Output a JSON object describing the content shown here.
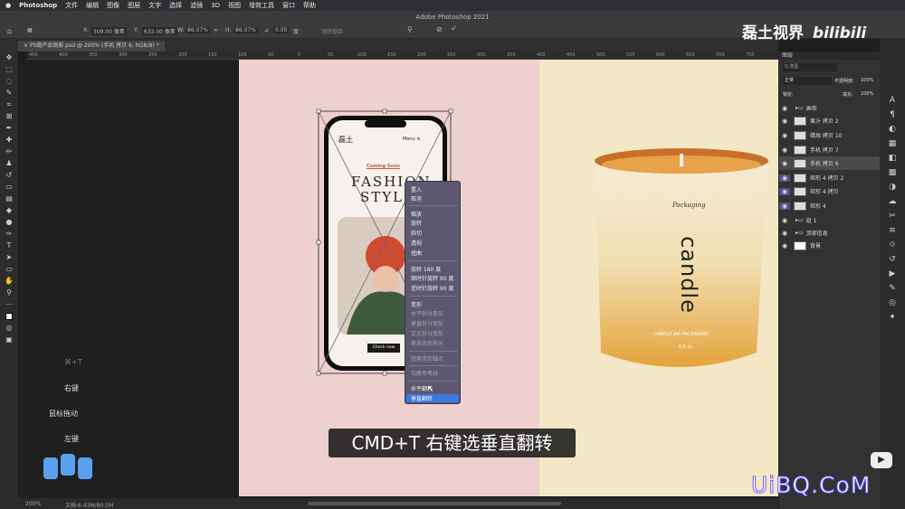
{
  "menubar": {
    "apple": "",
    "app": "Photoshop",
    "items": [
      "文件",
      "编辑",
      "图像",
      "图层",
      "文字",
      "选择",
      "滤镜",
      "3D",
      "视图",
      "增效工具",
      "窗口",
      "帮助"
    ]
  },
  "window_title": "Adobe Photoshop 2021",
  "options": {
    "x_label": "X:",
    "x_value": "309.00 像素",
    "y_label": "Y:",
    "y_value": "633.00 像素",
    "w_label": "W:",
    "w_value": "86.07%",
    "h_label": "H:",
    "h_value": "86.07%",
    "angle_value": "0.00",
    "angle_unit": "度",
    "interp": "消除锯齿"
  },
  "document_tab": "PS做产品倒影.psd @ 200% (手机 拷贝 6, RGB/8) *",
  "ruler_ticks": [
    "450",
    "400",
    "350",
    "300",
    "250",
    "200",
    "150",
    "100",
    "50",
    "0",
    "50",
    "100",
    "150",
    "200",
    "250",
    "300",
    "350",
    "400",
    "450",
    "500",
    "550",
    "600",
    "650",
    "700",
    "750"
  ],
  "keys": {
    "shortcut": "⌘+T",
    "right_click": "右键",
    "mouse_drag": "鼠标拖动",
    "left_click": "左键"
  },
  "status": {
    "zoom": "200%",
    "doc": "文档:6.43M/80.5M"
  },
  "phone": {
    "brand": "磊土",
    "menu": "Menu ≡",
    "coming": "Coming Soon",
    "line1": "FASHION",
    "line2": "STYLE",
    "cta": "Check now"
  },
  "candle": {
    "brand": "Packaging",
    "word": "candle",
    "sub": "CANDLE JAR PACKAGING",
    "oz": "6.5 oz"
  },
  "context_menu": {
    "items": [
      {
        "label": "置入",
        "disabled": false
      },
      {
        "label": "取消",
        "disabled": false
      },
      {
        "label": "缩放",
        "disabled": false
      },
      {
        "label": "旋转",
        "disabled": false
      },
      {
        "label": "斜切",
        "disabled": false
      },
      {
        "label": "透视",
        "disabled": false
      },
      {
        "label": "扭曲",
        "disabled": false
      },
      {
        "label": "旋转 180 度",
        "disabled": false
      },
      {
        "label": "顺时针旋转 90 度",
        "disabled": false
      },
      {
        "label": "逆时针旋转 90 度",
        "disabled": false
      },
      {
        "label": "变形",
        "disabled": false
      },
      {
        "label": "水平拆分变形",
        "disabled": true
      },
      {
        "label": "垂直拆分变形",
        "disabled": true
      },
      {
        "label": "交叉拆分变形",
        "disabled": true
      },
      {
        "label": "移去变形拆分",
        "disabled": true
      },
      {
        "label": "转换变形锚点",
        "disabled": true
      },
      {
        "label": "切换参考线",
        "disabled": true
      },
      {
        "label": "水平翻转",
        "disabled": false
      },
      {
        "label": "垂直翻转",
        "disabled": false
      }
    ]
  },
  "subtitle": "CMD+T 右键选垂直翻转",
  "layers_panel": {
    "title": "图层",
    "filter": "Q 类型",
    "blend": "正常",
    "opacity_label": "不透明度:",
    "opacity": "100%",
    "lock_label": "锁定:",
    "fill_label": "填充:",
    "fill": "100%",
    "layers": [
      "画布",
      "果汁 拷贝 2",
      "蜡烛 拷贝 10",
      "手机 拷贝 7",
      "手机 拷贝 6",
      "矩形 4 拷贝 2",
      "矩形 4 拷贝",
      "矩形 4",
      "组 1",
      "顶部信息",
      "背景"
    ]
  },
  "watermark": "磊土视界",
  "bilibili": "bilibili",
  "site": "UiBQ.CoM"
}
